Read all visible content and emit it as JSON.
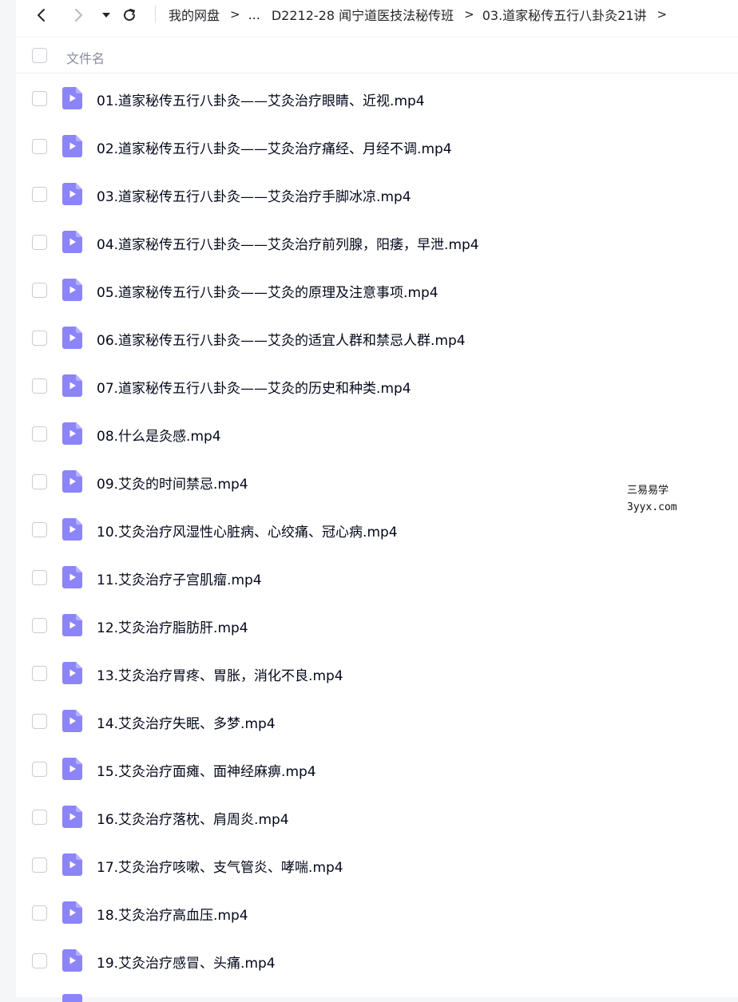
{
  "toolbar": {
    "back_icon": "chevron-left-icon",
    "forward_icon": "chevron-right-icon",
    "dropdown_icon": "caret-down-icon",
    "refresh_icon": "refresh-icon",
    "breadcrumb": [
      "我的网盘",
      "...",
      "D2212-28 闻宁道医技法秘传班",
      "03.道家秘传五行八卦灸21讲"
    ],
    "separator": ">"
  },
  "header": {
    "column_label": "文件名"
  },
  "files": [
    {
      "name": "01.道家秘传五行八卦灸——艾灸治疗眼睛、近视.mp4"
    },
    {
      "name": "02.道家秘传五行八卦灸——艾灸治疗痛经、月经不调.mp4"
    },
    {
      "name": "03.道家秘传五行八卦灸——艾灸治疗手脚冰凉.mp4"
    },
    {
      "name": "04.道家秘传五行八卦灸——艾灸治疗前列腺，阳痿，早泄.mp4"
    },
    {
      "name": "05.道家秘传五行八卦灸——艾灸的原理及注意事项.mp4"
    },
    {
      "name": "06.道家秘传五行八卦灸——艾灸的适宜人群和禁忌人群.mp4"
    },
    {
      "name": "07.道家秘传五行八卦灸——艾灸的历史和种类.mp4"
    },
    {
      "name": "08.什么是灸感.mp4"
    },
    {
      "name": "09.艾灸的时间禁忌.mp4"
    },
    {
      "name": "10.艾灸治疗风湿性心脏病、心绞痛、冠心病.mp4"
    },
    {
      "name": "11.艾灸治疗子宫肌瘤.mp4"
    },
    {
      "name": "12.艾灸治疗脂肪肝.mp4"
    },
    {
      "name": "13.艾灸治疗胃疼、胃胀，消化不良.mp4"
    },
    {
      "name": "14.艾灸治疗失眠、多梦.mp4"
    },
    {
      "name": "15.艾灸治疗面瘫、面神经麻痹.mp4"
    },
    {
      "name": "16.艾灸治疗落枕、肩周炎.mp4"
    },
    {
      "name": "17.艾灸治疗咳嗽、支气管炎、哮喘.mp4"
    },
    {
      "name": "18.艾灸治疗高血压.mp4"
    },
    {
      "name": "19.艾灸治疗感冒、头痛.mp4"
    }
  ],
  "file_icon": "video-file-icon",
  "colors": {
    "icon_purple": "#8b85f7",
    "text": "#03081a",
    "muted": "#878c9c"
  },
  "watermark": {
    "line1": "三易易学",
    "line2": "3yyx.com"
  }
}
